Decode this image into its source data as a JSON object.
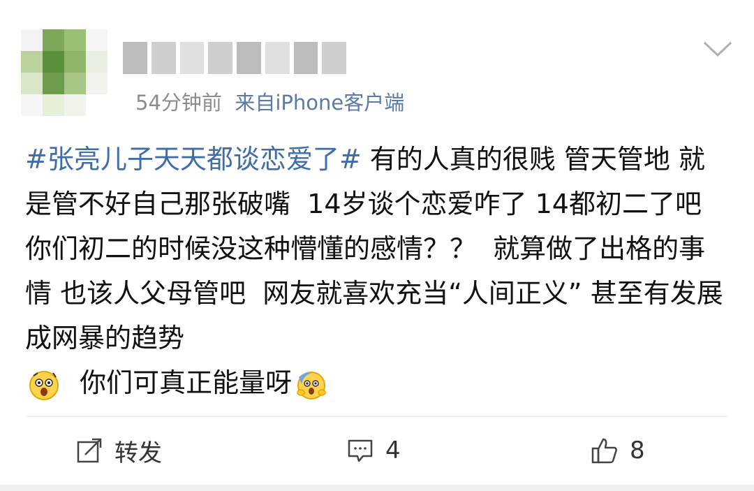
{
  "post": {
    "meta": {
      "time": "54分钟前",
      "source": "来自iPhone客户端"
    },
    "content": {
      "topic": "#张亮儿子天天都谈恋爱了#",
      "text": " 有的人真的很贱 管天管地 就是管不好自己那张破嘴  14岁谈个恋爱咋了 14都初二了吧   你们初二的时候没这种懵懂的感情？？  就算做了出格的事情 也该人父母管吧  网友就喜欢充当“人间正义” 甚至有发展成网暴的趋势",
      "tail_text": "  你们可真正能量呀",
      "emoji_1": "shocked-face-emoji",
      "emoji_2": "scared-face-emoji"
    },
    "actions": {
      "repost_label": "转发",
      "comment_count": "4",
      "like_count": "8"
    },
    "colors": {
      "topic": "#3f6da8",
      "meta": "#8c8c8c",
      "source": "#5a7aa8"
    }
  }
}
